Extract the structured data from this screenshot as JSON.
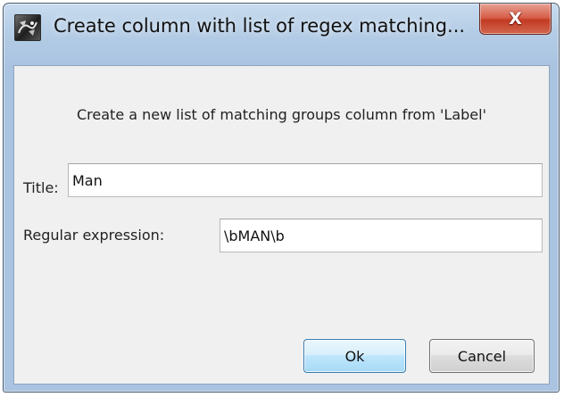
{
  "window": {
    "title": "Create column with list of regex matching...",
    "close_glyph": "X",
    "icon": "app-icon"
  },
  "dialog": {
    "message": "Create a new list of matching groups column from 'Label'",
    "title_label": "Title:",
    "title_value": "Man",
    "regex_label": "Regular expression:",
    "regex_value": "\\bMAN\\b",
    "ok_label": "Ok",
    "cancel_label": "Cancel"
  },
  "colors": {
    "frame": "#a9c3e1",
    "client_background": "#f0f0f0",
    "close_button": "#c23a22",
    "default_button": "#bee6fd"
  }
}
